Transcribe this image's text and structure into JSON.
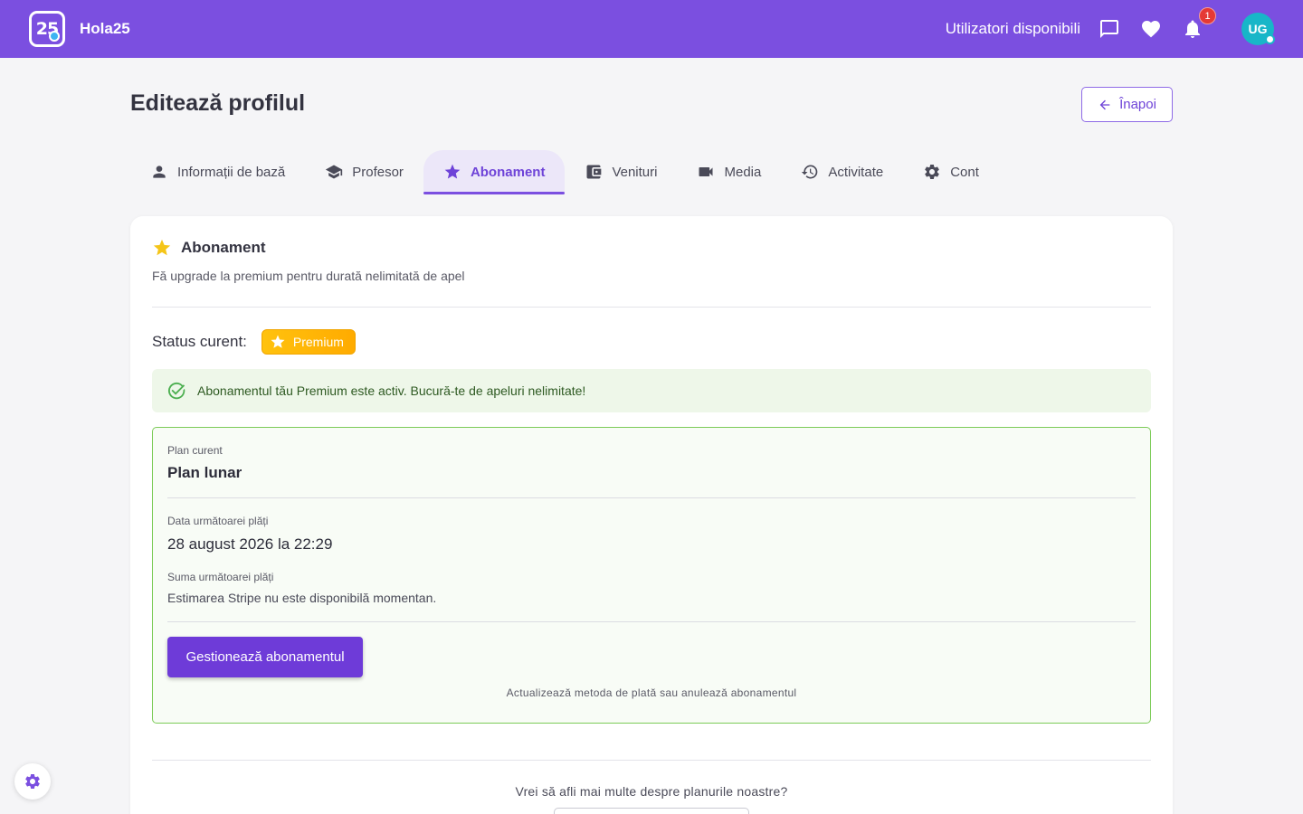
{
  "header": {
    "logo_text": "25",
    "brand": "Hola25",
    "available_users": "Utilizatori disponibili",
    "notification_count": "1",
    "avatar_initials": "UG"
  },
  "page": {
    "title": "Editează profilul",
    "back_label": "Înapoi"
  },
  "tabs": [
    {
      "label": "Informații de bază",
      "icon": "person-icon"
    },
    {
      "label": "Profesor",
      "icon": "graduation-cap-icon"
    },
    {
      "label": "Abonament",
      "icon": "star-icon",
      "active": true
    },
    {
      "label": "Venituri",
      "icon": "wallet-icon"
    },
    {
      "label": "Media",
      "icon": "video-camera-icon"
    },
    {
      "label": "Activitate",
      "icon": "history-icon"
    },
    {
      "label": "Cont",
      "icon": "gear-icon"
    }
  ],
  "subscription": {
    "title": "Abonament",
    "subtitle": "Fă upgrade la premium pentru durată nelimitată de apel",
    "status_label": "Status curent:",
    "status_chip": "Premium",
    "alert": "Abonamentul tău Premium este activ. Bucură-te de apeluri nelimitate!",
    "plan_label": "Plan curent",
    "plan_value": "Plan lunar",
    "next_date_label": "Data următoarei plăți",
    "next_date_value": "28 august 2026 la 22:29",
    "next_amount_label": "Suma următoarei plăți",
    "next_amount_value": "Estimarea Stripe nu este disponibilă momentan.",
    "manage_button": "Gestionează abonamentul",
    "manage_note": "Actualizează metoda de plată sau anulează abonamentul",
    "more_info": "Vrei să afli mai multe despre planurile noastre?"
  },
  "colors": {
    "primary": "#7b4fe0",
    "success": "#4caf50",
    "premium": "#ffc20e"
  }
}
